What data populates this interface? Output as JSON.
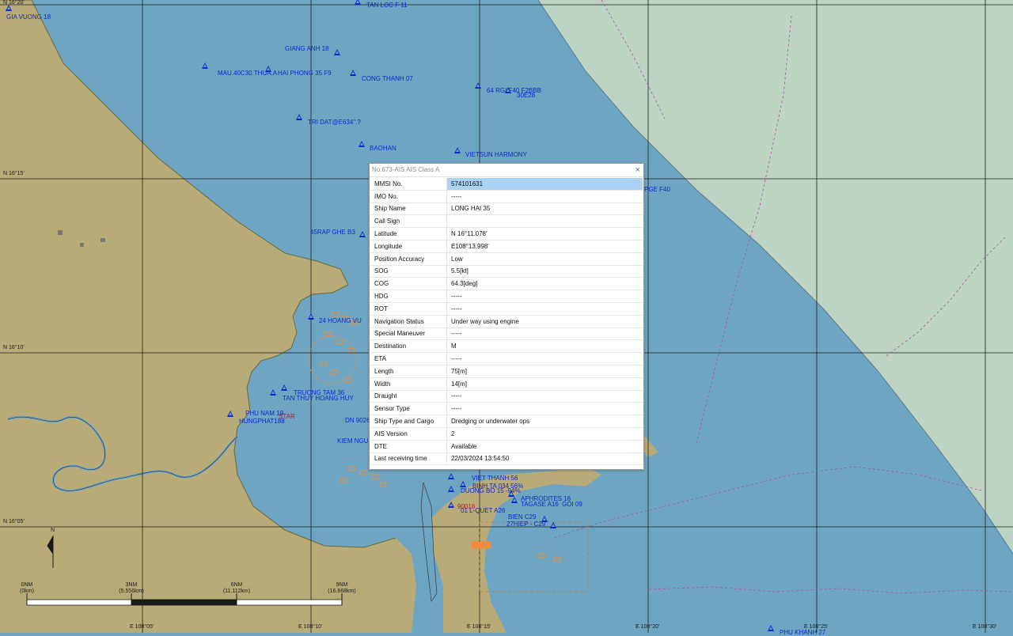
{
  "map": {
    "colors": {
      "sea": "#6ea5c3",
      "deep": "#bdd4c2",
      "land": "#b9ab78",
      "grid": "#1c1c1c",
      "vessel": "#1028c8",
      "alert": "#c8102e",
      "cluster": "#f08c3c"
    },
    "lat_labels": [
      "N 16°15'",
      "N 16°10'",
      "N 16°05'"
    ],
    "lon_labels": [
      "E 108°05'",
      "E 108°10'",
      "E 108°15'",
      "E 108°20'",
      "E 108°25'",
      "E 108°30'"
    ],
    "top_label": "N 16°20'",
    "north_label": "N",
    "scale": {
      "ticks": [
        {
          "nm": "0NM",
          "km": "(0km)"
        },
        {
          "nm": "3NM",
          "km": "(5.556km)"
        },
        {
          "nm": "6NM",
          "km": "(11.112km)"
        },
        {
          "nm": "9NM",
          "km": "(16.668km)"
        }
      ]
    },
    "vessels": [
      {
        "name": "GIA VUONG 18"
      },
      {
        "name": "TAN LOC F 11"
      },
      {
        "name": "GIANG ANH 18"
      },
      {
        "name": "MAU.40C30.THUA.A"
      },
      {
        "name": "HAI PHONG 35 F9"
      },
      {
        "name": "CONG THANH 07"
      },
      {
        "name": "64 RG/ F40 F2BBB"
      },
      {
        "name": "30E28"
      },
      {
        "name": "TRI DAT@E634\".?"
      },
      {
        "name": "BAOHAN"
      },
      {
        "name": "VIETSUN HARMONY"
      },
      {
        "name": "PGE F40"
      },
      {
        "name": "45RAP GHE B3"
      },
      {
        "name": "24 HOANG VU"
      },
      {
        "name": "TRUONG TAM 36"
      },
      {
        "name": "TAN THUY HOANG HUY"
      },
      {
        "name": "HUNGPHAT188"
      },
      {
        "name": "PHU NAM 19"
      },
      {
        "name": "DN 9026"
      },
      {
        "name": "KIEM NGU"
      },
      {
        "name": "VIET THANH 56"
      },
      {
        "name": "BINH TA 034 56%"
      },
      {
        "name": "DUONG BO 15 -94%"
      },
      {
        "name": "APHRODITES 16"
      },
      {
        "name": "TAGASE A16"
      },
      {
        "name": "GOI 09"
      },
      {
        "name": "01 L-QUET A26"
      },
      {
        "name": "BIEN C29"
      },
      {
        "name": "27HIEP - C29"
      },
      {
        "name": "PHU KHANH 27"
      }
    ],
    "alerts": [
      {
        "name": "STAR"
      },
      {
        "name": "90018"
      }
    ]
  },
  "ais_dialog": {
    "title": "No.673-AIS AIS Class A",
    "close_symbol": "×",
    "rows": [
      {
        "key": "MMSI No.",
        "value": "574101631"
      },
      {
        "key": "IMO No.",
        "value": "-----"
      },
      {
        "key": "Ship Name",
        "value": "LONG HAI 35"
      },
      {
        "key": "Call Sign",
        "value": ""
      },
      {
        "key": "Latitude",
        "value": "N 16°11.078'"
      },
      {
        "key": "Longitude",
        "value": "E108°13.998'"
      },
      {
        "key": "Position Accuracy",
        "value": "Low"
      },
      {
        "key": "SOG",
        "value": "5.5[kt]"
      },
      {
        "key": "COG",
        "value": "64.3[deg]"
      },
      {
        "key": "HDG",
        "value": "-----"
      },
      {
        "key": "ROT",
        "value": "-----"
      },
      {
        "key": "Navigation Status",
        "value": "Under way using engine"
      },
      {
        "key": "Special Maneuver",
        "value": "-----"
      },
      {
        "key": "Destination",
        "value": "M"
      },
      {
        "key": "ETA",
        "value": "-----"
      },
      {
        "key": "Length",
        "value": "75[m]"
      },
      {
        "key": "Width",
        "value": "14[m]"
      },
      {
        "key": "Draught",
        "value": "-----"
      },
      {
        "key": "Sensor Type",
        "value": "-----"
      },
      {
        "key": "Ship Type and Cargo",
        "value": "Dredging or underwater ops"
      },
      {
        "key": "AIS Version",
        "value": "2"
      },
      {
        "key": "DTE",
        "value": "Available"
      },
      {
        "key": "Last receiving time",
        "value": "22/03/2024 13:54:50"
      }
    ]
  }
}
